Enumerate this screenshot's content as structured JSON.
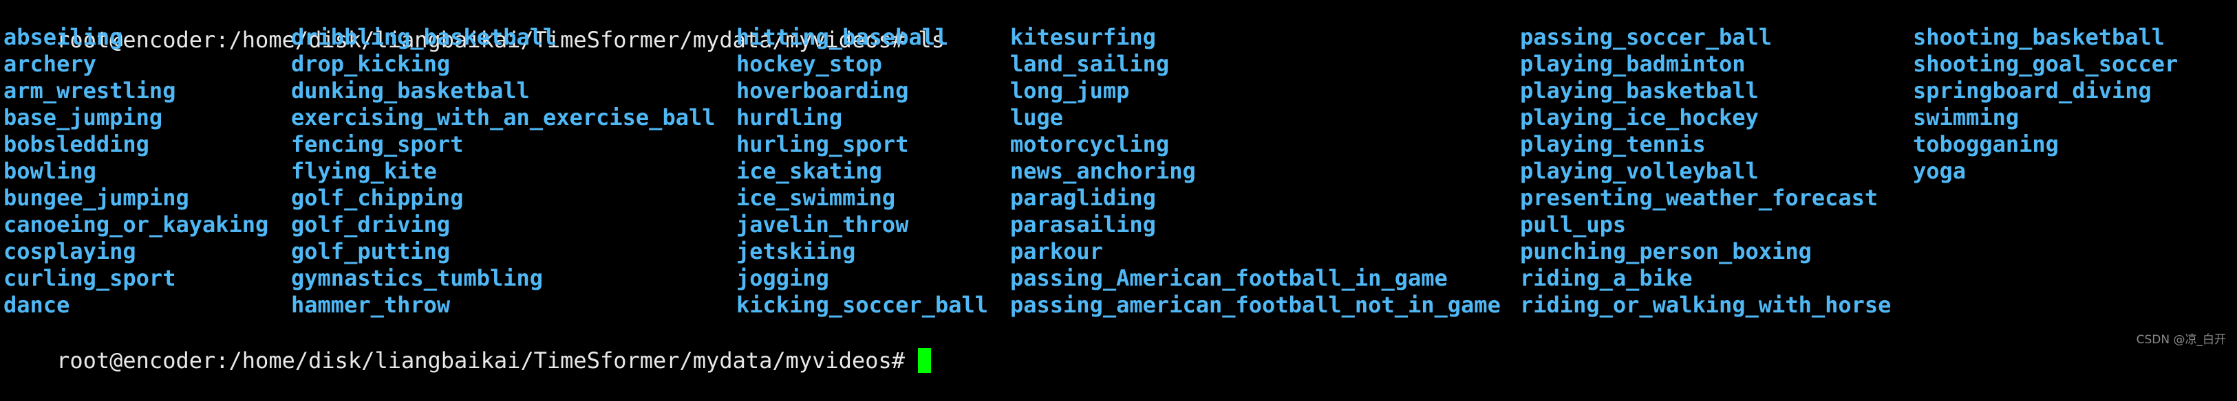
{
  "terminal": {
    "prompt": "root@encoder:/home/disk/liangbaikai/TimeSformer/mydata/myvideos#",
    "command": "ls",
    "cursor_color": "#00ff00",
    "directory_color": "#4fb8f5",
    "columns": [
      [
        "abseiling",
        "archery",
        "arm_wrestling",
        "base_jumping",
        "bobsledding",
        "bowling",
        "bungee_jumping",
        "canoeing_or_kayaking",
        "cosplaying",
        "curling_sport",
        "dance"
      ],
      [
        "dribbling_basketball",
        "drop_kicking",
        "dunking_basketball",
        "exercising_with_an_exercise_ball",
        "fencing_sport",
        "flying_kite",
        "golf_chipping",
        "golf_driving",
        "golf_putting",
        "gymnastics_tumbling",
        "hammer_throw"
      ],
      [
        "hitting_baseball",
        "hockey_stop",
        "hoverboarding",
        "hurdling",
        "hurling_sport",
        "ice_skating",
        "ice_swimming",
        "javelin_throw",
        "jetskiing",
        "jogging",
        "kicking_soccer_ball"
      ],
      [
        "kitesurfing",
        "land_sailing",
        "long_jump",
        "luge",
        "motorcycling",
        "news_anchoring",
        "paragliding",
        "parasailing",
        "parkour",
        "passing_American_football_in_game",
        "passing_american_football_not_in_game"
      ],
      [
        "passing_soccer_ball",
        "playing_badminton",
        "playing_basketball",
        "playing_ice_hockey",
        "playing_tennis",
        "playing_volleyball",
        "presenting_weather_forecast",
        "pull_ups",
        "punching_person_boxing",
        "riding_a_bike",
        "riding_or_walking_with_horse"
      ],
      [
        "shooting_basketball",
        "shooting_goal_soccer",
        "springboard_diving",
        "swimming",
        "tobogganing",
        "yoga"
      ]
    ]
  },
  "watermark": "CSDN @凉_白开"
}
